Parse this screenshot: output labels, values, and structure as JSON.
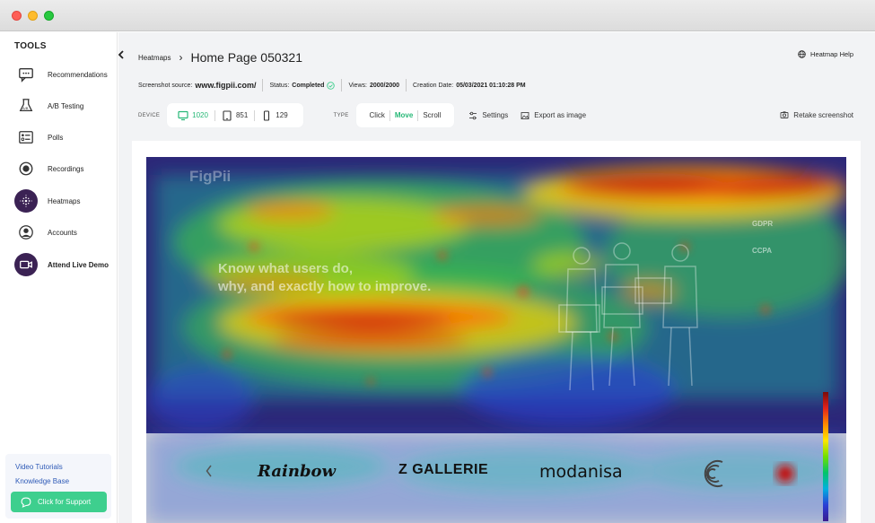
{
  "sidebar": {
    "title": "TOOLS",
    "items": [
      {
        "label": "Recommendations"
      },
      {
        "label": "A/B Testing"
      },
      {
        "label": "Polls"
      },
      {
        "label": "Recordings"
      },
      {
        "label": "Heatmaps"
      },
      {
        "label": "Accounts"
      },
      {
        "label": "Attend Live Demo"
      }
    ],
    "help": {
      "video_tutorials": "Video Tutorials",
      "knowledge_base": "Knowledge Base",
      "support": "Click for Support"
    }
  },
  "header": {
    "breadcrumb_parent": "Heatmaps",
    "page_title": "Home Page 050321",
    "help_label": "Heatmap Help"
  },
  "meta": {
    "source_label": "Screenshot source:",
    "source_value": "www.figpii.com/",
    "status_label": "Status:",
    "status_value": "Completed",
    "views_label": "Views:",
    "views_value": "2000/2000",
    "date_label": "Creation Date:",
    "date_value": "05/03/2021 01:10:28 PM"
  },
  "toolbar": {
    "device_label": "DEVICE",
    "devices": [
      {
        "label": "1020",
        "icon": "desktop-icon",
        "active": true
      },
      {
        "label": "851",
        "icon": "tablet-icon",
        "active": false
      },
      {
        "label": "129",
        "icon": "phone-icon",
        "active": false
      }
    ],
    "type_label": "TYPE",
    "types": [
      {
        "label": "Click",
        "active": false
      },
      {
        "label": "Move",
        "active": true
      },
      {
        "label": "Scroll",
        "active": false
      }
    ],
    "settings_label": "Settings",
    "export_label": "Export as image",
    "retake_label": "Retake screenshot"
  },
  "screenshot": {
    "logo_text": "FigPii",
    "headline_line1": "Know what users do,",
    "headline_line2": "why, and exactly how to improve.",
    "badge_gdpr": "GDPR",
    "badge_ccpa": "CCPA",
    "brands": [
      "Rainbow",
      "Z GALLERIE",
      "modanisa"
    ]
  },
  "colors": {
    "accent_green": "#3ecf8e",
    "sidebar_icon_bg": "#3b2254",
    "link_blue": "#2f5bb7"
  }
}
